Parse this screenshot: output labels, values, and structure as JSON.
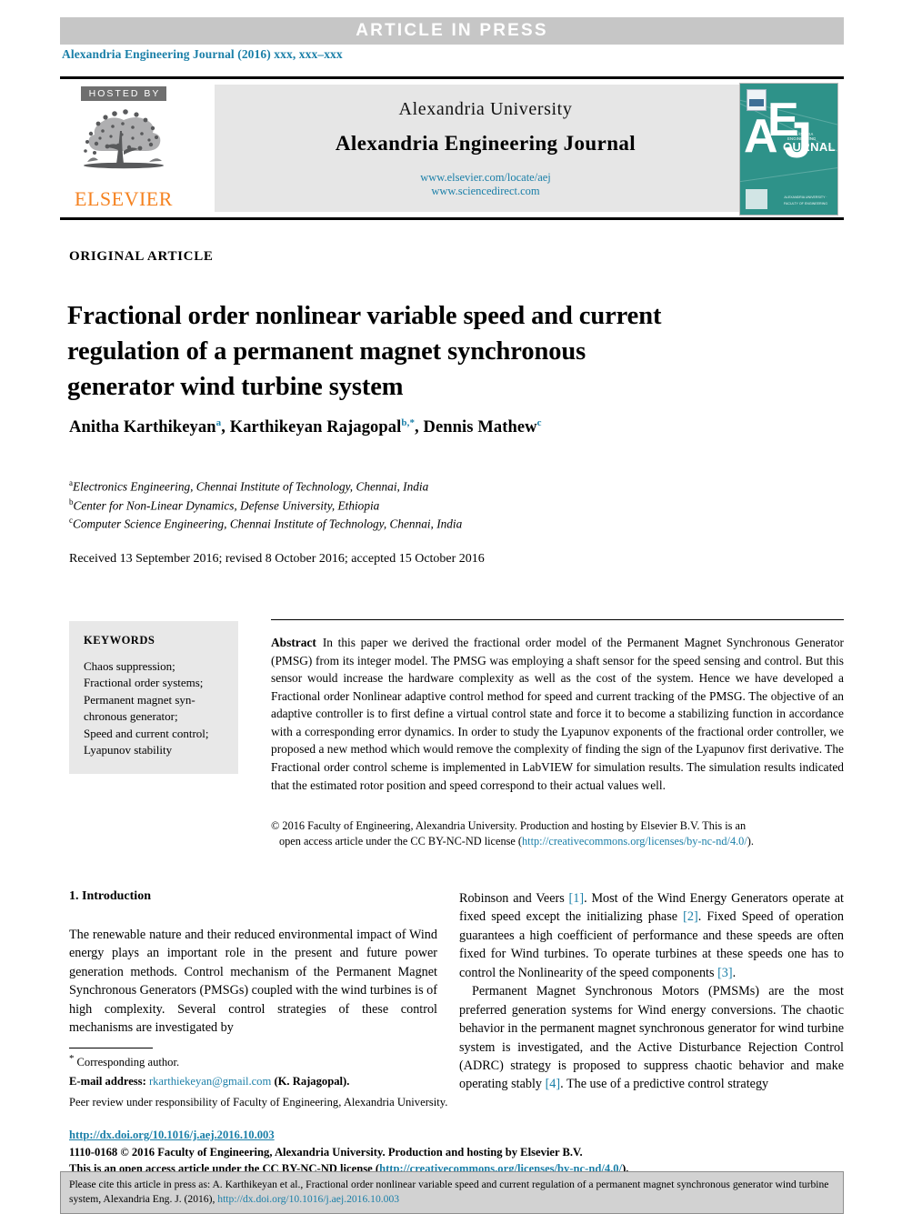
{
  "banner": {
    "text": "ARTICLE  IN  PRESS"
  },
  "journal_line": "Alexandria Engineering Journal (2016) xxx, xxx–xxx",
  "masthead": {
    "hosted_by": "HOSTED BY",
    "publisher": "ELSEVIER",
    "university": "Alexandria University",
    "journal_name": "Alexandria Engineering Journal",
    "url_primary": "www.elsevier.com/locate/aej",
    "url_secondary": "www.sciencedirect.com",
    "cover": {
      "letter_a": "A",
      "letter_e": "E",
      "letter_j": "J",
      "journal_word": "OURNAL",
      "journal_sub": "ALEXANDRIA ENGINEERING",
      "foot_text": "ALEXANDRIA UNIVERSITY · FACULTY OF ENGINEERING"
    }
  },
  "article_type": "ORIGINAL ARTICLE",
  "title": "Fractional order nonlinear variable speed and current regulation of a permanent magnet synchronous generator wind turbine system",
  "authors": [
    {
      "name": "Anitha Karthikeyan",
      "marks": "a"
    },
    {
      "name": "Karthikeyan Rajagopal",
      "marks": "b,*"
    },
    {
      "name": "Dennis Mathew",
      "marks": "c"
    }
  ],
  "affiliations": [
    {
      "mark": "a",
      "text": "Electronics Engineering, Chennai Institute of Technology, Chennai, India"
    },
    {
      "mark": "b",
      "text": "Center for Non-Linear Dynamics, Defense University, Ethiopia"
    },
    {
      "mark": "c",
      "text": "Computer Science Engineering, Chennai Institute of Technology, Chennai, India"
    }
  ],
  "received_line": "Received 13 September 2016; revised 8 October 2016; accepted 15 October 2016",
  "keywords": {
    "heading": "KEYWORDS",
    "items": [
      "Chaos suppression;",
      "Fractional order systems;",
      "Permanent magnet syn-",
      "chronous generator;",
      "Speed and current control;",
      "Lyapunov stability"
    ]
  },
  "abstract": {
    "label": "Abstract",
    "body": "In this paper we derived the fractional order model of the Permanent Magnet Synchronous Generator (PMSG) from its integer model. The PMSG was employing a shaft sensor for the speed sensing and control. But this sensor would increase the hardware complexity as well as the cost of the system. Hence we have developed a Fractional order Nonlinear adaptive control method for speed and current tracking of the PMSG. The objective of an adaptive controller is to first define a virtual control state and force it to become a stabilizing function in accordance with a corresponding error dynamics. In order to study the Lyapunov exponents of the fractional order controller, we proposed a new method which would remove the complexity of finding the sign of the Lyapunov first derivative. The Fractional order control scheme is implemented in LabVIEW for simulation results. The simulation results indicated that the estimated rotor position and speed correspond to their actual values well.",
    "copyright_line1": "© 2016 Faculty of Engineering, Alexandria University. Production and hosting by Elsevier B.V. This is an",
    "copyright_line2_pre": "open access article under the CC BY-NC-ND license (",
    "copyright_license_url": "http://creativecommons.org/licenses/by-nc-nd/4.0/",
    "copyright_line2_post": ")."
  },
  "introduction": {
    "heading": "1. Introduction",
    "left_paragraph": "The renewable nature and their reduced environmental impact of Wind energy plays an important role in the present and future power generation methods. Control mechanism of the Permanent Magnet Synchronous Generators (PMSGs) coupled with the wind turbines is of high complexity. Several control strategies of these control mechanisms are investigated by",
    "right_paragraph_1_a": "Robinson and Veers ",
    "right_ref_1": "[1]",
    "right_paragraph_1_b": ". Most of the Wind Energy Generators operate at fixed speed except the initializing phase ",
    "right_ref_2": "[2]",
    "right_paragraph_1_c": ". Fixed Speed of operation guarantees a high coefficient of performance and these speeds are often fixed for Wind turbines. To operate turbines at these speeds one has to control the Nonlinearity of the speed components ",
    "right_ref_3": "[3]",
    "right_paragraph_1_d": ".",
    "right_paragraph_2_a": "Permanent Magnet Synchronous Motors (PMSMs) are the most preferred generation systems for Wind energy conversions. The chaotic behavior in the permanent magnet synchronous generator for wind turbine system is investigated, and the Active Disturbance Rejection Control (ADRC) strategy is proposed to suppress chaotic behavior and make operating stably ",
    "right_ref_4": "[4]",
    "right_paragraph_2_b": ". The use of a predictive control strategy"
  },
  "footnotes": {
    "corresponding": "Corresponding author.",
    "email_label": "E-mail address:",
    "email": "rkarthiekeyan@gmail.com",
    "email_owner": "(K. Rajagopal).",
    "peer_review": "Peer review under responsibility of Faculty of Engineering, Alexandria University."
  },
  "doi_block": {
    "doi_url": "http://dx.doi.org/10.1016/j.aej.2016.10.003",
    "issn_line": "1110-0168 © 2016 Faculty of Engineering, Alexandria University. Production and hosting by Elsevier B.V.",
    "license_pre": "This is an open access article under the CC BY-NC-ND license (",
    "license_url": "http://creativecommons.org/licenses/by-nc-nd/4.0/",
    "license_post": ")."
  },
  "citation_box": {
    "text_pre": "Please cite this article in press as: A. Karthikeyan et al., Fractional order nonlinear variable speed and current regulation of a permanent magnet synchronous generator wind turbine system,  Alexandria Eng. J. (2016), ",
    "url": "http://dx.doi.org/10.1016/j.aej.2016.10.003"
  }
}
